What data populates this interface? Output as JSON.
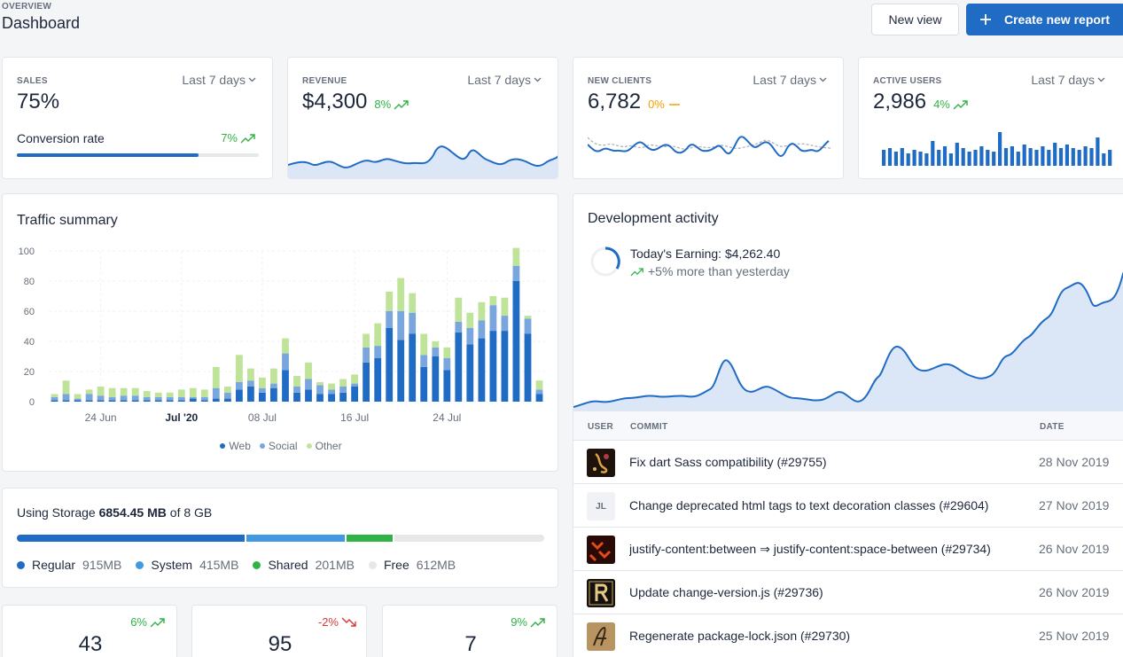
{
  "header": {
    "pretitle": "OVERVIEW",
    "title": "Dashboard",
    "new_view_label": "New view",
    "create_report_label": "Create new report"
  },
  "cards": {
    "sales": {
      "label": "SALES",
      "range": "Last 7 days",
      "value": "75%",
      "sub_label": "Conversion rate",
      "sub_delta": "7%",
      "progress": 0.75
    },
    "revenue": {
      "label": "REVENUE",
      "range": "Last 7 days",
      "value": "$4,300",
      "delta": "8%"
    },
    "new_clients": {
      "label": "NEW CLIENTS",
      "range": "Last 7 days",
      "value": "6,782",
      "delta": "0%"
    },
    "active_users": {
      "label": "ACTIVE USERS",
      "range": "Last 7 days",
      "value": "2,986",
      "delta": "4%"
    }
  },
  "traffic": {
    "title": "Traffic summary",
    "chart_data": {
      "type": "bar",
      "stacked": true,
      "y_ticks": [
        "100",
        "80",
        "60",
        "40",
        "20",
        "0"
      ],
      "ylim": [
        0,
        100
      ],
      "x_ticks": [
        "24 Jun",
        "Jul '20",
        "08 Jul",
        "16 Jul",
        "24 Jul"
      ],
      "legend": [
        "Web",
        "Social",
        "Other"
      ],
      "colors": [
        "#206bc4",
        "#79a6dc",
        "#bfe399"
      ],
      "series": [
        {
          "name": "Web",
          "values": [
            1,
            1,
            1,
            1,
            1,
            1,
            1,
            1,
            1,
            1,
            1,
            1,
            2,
            1,
            2,
            2,
            8,
            10,
            6,
            9,
            21,
            6,
            8,
            5,
            5,
            6,
            10,
            26,
            29,
            49,
            41,
            45,
            23,
            30,
            21,
            46,
            38,
            42,
            47,
            47,
            80,
            45,
            5
          ]
        },
        {
          "name": "Social",
          "values": [
            2,
            4,
            1,
            4,
            3,
            2,
            3,
            3,
            2,
            2,
            2,
            2,
            1,
            2,
            7,
            4,
            5,
            4,
            3,
            3,
            11,
            4,
            7,
            6,
            3,
            4,
            2,
            10,
            8,
            11,
            19,
            14,
            8,
            6,
            8,
            7,
            11,
            12,
            17,
            10,
            10,
            10,
            3
          ]
        },
        {
          "name": "Other",
          "values": [
            2,
            9,
            3,
            3,
            6,
            6,
            5,
            5,
            4,
            3,
            3,
            5,
            6,
            5,
            14,
            4,
            18,
            8,
            7,
            10,
            10,
            7,
            11,
            2,
            4,
            5,
            6,
            9,
            15,
            13,
            22,
            13,
            14,
            4,
            7,
            16,
            10,
            12,
            6,
            12,
            12,
            2,
            6
          ]
        }
      ]
    }
  },
  "storage": {
    "prefix": "Using Storage",
    "used": "6854.45 MB",
    "suffix": "of 8 GB",
    "segments": [
      {
        "name": "Regular",
        "value": "915MB",
        "color": "#206bc4",
        "fraction": 0.4367
      },
      {
        "name": "System",
        "value": "415MB",
        "color": "#4299e1",
        "fraction": 0.1881
      },
      {
        "name": "Shared",
        "value": "201MB",
        "color": "#2fb344",
        "fraction": 0.0876
      },
      {
        "name": "Free",
        "value": "612MB",
        "color": "#e6e7e9",
        "fraction": 0.2876
      }
    ]
  },
  "mini_cards": [
    {
      "value": "43",
      "delta": "6%"
    },
    {
      "value": "95",
      "delta": "-2%"
    },
    {
      "value": "7",
      "delta": "9%"
    }
  ],
  "dev": {
    "title": "Development activity",
    "earning": "Today's Earning: $4,262.40",
    "growth": "+5% more than yesterday",
    "columns": [
      "USER",
      "COMMIT",
      "DATE"
    ],
    "rows": [
      {
        "avatar": "img1",
        "commit": "Fix dart Sass compatibility (#29755)",
        "date": "28 Nov 2019"
      },
      {
        "avatar": "JL",
        "commit": "Change deprecated html tags to text decoration classes (#29604)",
        "date": "27 Nov 2019"
      },
      {
        "avatar": "img3",
        "commit": "justify-content:between ⇒ justify-content:space-between (#29734)",
        "date": "26 Nov 2019"
      },
      {
        "avatar": "img4",
        "commit": "Update change-version.js (#29736)",
        "date": "26 Nov 2019"
      },
      {
        "avatar": "img5",
        "commit": "Regenerate package-lock.json (#29730)",
        "date": "25 Nov 2019"
      }
    ]
  },
  "colors": {
    "primary": "#206bc4",
    "green": "#2fb344",
    "yellow": "#f59f00",
    "red": "#d63939"
  }
}
